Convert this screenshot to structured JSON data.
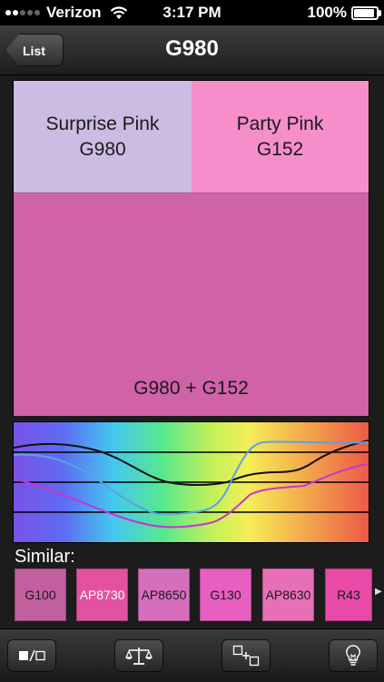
{
  "status_bar": {
    "carrier": "Verizon",
    "time": "3:17 PM",
    "battery": "100%",
    "battery_level": 1.0
  },
  "nav": {
    "back_label": "List",
    "title": "G980"
  },
  "swatches": {
    "a": {
      "name": "Surprise Pink",
      "code": "G980",
      "color": "#ccbbe2"
    },
    "b": {
      "name": "Party Pink",
      "code": "G152",
      "color": "#f68ec9"
    },
    "mix": {
      "label": "G980 + G152",
      "color": "#d062a8"
    }
  },
  "similar": {
    "label": "Similar:",
    "items": [
      {
        "code": "G100",
        "color": "#c2609f",
        "text_color": "#1a1a1a"
      },
      {
        "code": "AP8730",
        "color": "#e3529f",
        "text_color": "#ffffff"
      },
      {
        "code": "AP8650",
        "color": "#d66dbd",
        "text_color": "#1a1a1a"
      },
      {
        "code": "G130",
        "color": "#e75fc0",
        "text_color": "#1a1a1a"
      },
      {
        "code": "AP8630",
        "color": "#e76fb8",
        "text_color": "#1a1a1a"
      },
      {
        "code": "R43",
        "color": "#e94aa8",
        "text_color": "#1a1a1a"
      }
    ]
  },
  "toolbar": {
    "buttons": [
      {
        "icon": "square-toggle-icon"
      },
      {
        "icon": "balance-scale-icon"
      },
      {
        "icon": "add-mix-icon"
      },
      {
        "icon": "lightbulb-icon"
      }
    ]
  },
  "colors": {
    "curve_a": "#111111",
    "curve_b": "#5aa3e0",
    "curve_mix": "#c535d4"
  }
}
